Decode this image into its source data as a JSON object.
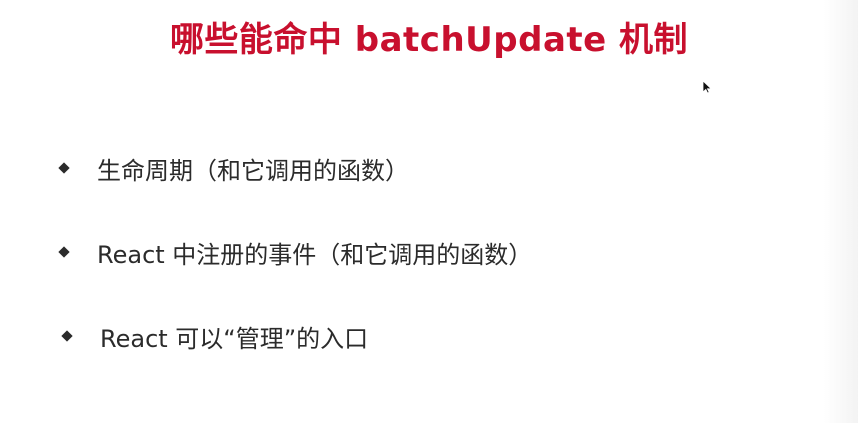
{
  "slide": {
    "title": "哪些能命中 batchUpdate 机制",
    "bullets": [
      {
        "text": "生命周期（和它调用的函数）"
      },
      {
        "text": "React 中注册的事件（和它调用的函数）"
      },
      {
        "text": "React 可以“管理”的入口"
      }
    ]
  },
  "colors": {
    "title": "#c8102e",
    "text": "#2b2b2b",
    "background": "#ffffff"
  },
  "icons": {
    "bullet": "diamond-bullet-icon",
    "pointer": "mouse-cursor-icon"
  }
}
